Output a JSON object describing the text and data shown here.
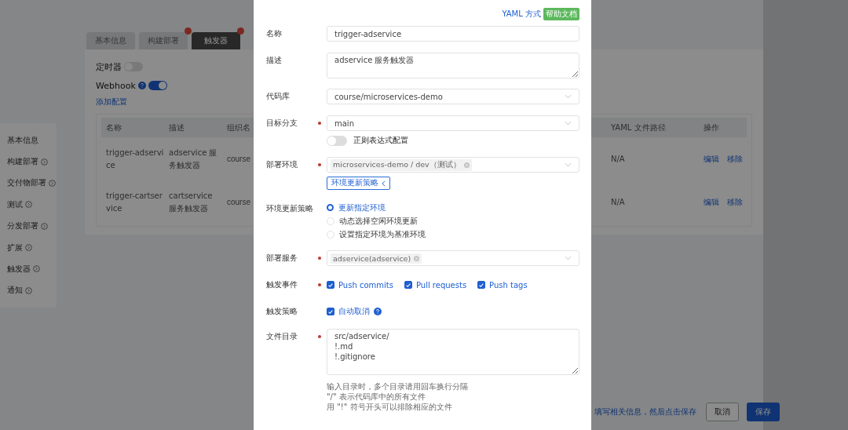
{
  "sidebar": [
    {
      "label": "基本信息",
      "expandable": false
    },
    {
      "label": "构建部署",
      "expandable": true
    },
    {
      "label": "交付物部署",
      "expandable": true
    },
    {
      "label": "测试",
      "expandable": true
    },
    {
      "label": "分发部署",
      "expandable": true
    },
    {
      "label": "扩展",
      "expandable": true
    },
    {
      "label": "触发器",
      "expandable": true
    },
    {
      "label": "通知",
      "expandable": true
    }
  ],
  "tabs": [
    {
      "label": "基本信息",
      "selected": false,
      "error": false
    },
    {
      "label": "构建部署",
      "selected": false,
      "error": true
    },
    {
      "label": "触发器",
      "selected": true,
      "error": true
    }
  ],
  "timer": {
    "label": "定时器",
    "on": false
  },
  "webhook": {
    "label": "Webhook",
    "on": true
  },
  "add_config": "添加配置",
  "table": {
    "columns": [
      "名称",
      "描述",
      "组织名",
      "YAML 文件路径",
      "操作"
    ],
    "rows": [
      {
        "cells": [
          "trigger-adservice",
          "adservice 服务触发器",
          "course",
          "N/A"
        ],
        "actions": [
          "编辑",
          "移除"
        ]
      },
      {
        "cells": [
          "trigger-cartservice",
          "cartservice 服务触发器",
          "course",
          "N/A"
        ],
        "actions": [
          "编辑",
          "移除"
        ]
      }
    ]
  },
  "footer": {
    "hint": "填写相关信息，然后点击保存",
    "cancel": "取消",
    "save": "保存"
  },
  "modal": {
    "yaml_link": "YAML 方式",
    "help_badge": "帮助文档",
    "fields": [
      {
        "kind": "input",
        "label": "名称",
        "required": false,
        "value": "trigger-adservice"
      },
      {
        "kind": "textarea",
        "label": "描述",
        "required": false,
        "value": "adservice 服务触发器"
      },
      {
        "kind": "select",
        "label": "代码库",
        "required": false,
        "value": "course/microservices-demo"
      },
      {
        "kind": "select",
        "label": "目标分支",
        "required": true,
        "value": "main",
        "toggle": {
          "label": "正则表达式配置",
          "on": false
        }
      },
      {
        "kind": "tags",
        "label": "部署环境",
        "required": true,
        "tags": [
          "microservices-demo / dev（测试）"
        ],
        "button": "环境更新策略"
      },
      {
        "kind": "radios",
        "label": "环境更新策略",
        "required": false,
        "options": [
          {
            "label": "更新指定环境",
            "selected": true
          },
          {
            "label": "动态选择空闲环境更新",
            "selected": false
          },
          {
            "label": "设置指定环境为基准环境",
            "selected": false
          }
        ]
      },
      {
        "kind": "tags",
        "label": "部署服务",
        "required": true,
        "tags": [
          "adservice(adservice)"
        ]
      },
      {
        "kind": "checkboxes",
        "label": "触发事件",
        "required": true,
        "options": [
          {
            "label": "Push commits",
            "checked": true,
            "help": false
          },
          {
            "label": "Pull requests",
            "checked": true,
            "help": false
          },
          {
            "label": "Push tags",
            "checked": true,
            "help": false
          }
        ]
      },
      {
        "kind": "checkboxes",
        "label": "触发策略",
        "required": false,
        "options": [
          {
            "label": "自动取消",
            "checked": true,
            "help": true
          }
        ]
      },
      {
        "kind": "textarea",
        "label": "文件目录",
        "required": true,
        "value": "src/adservice/\n!.md\n!.gitignore",
        "hints": [
          "输入目录时，多个目录请用回车换行分隔",
          "\"/\" 表示代码库中的所有文件",
          "用 \"!\" 符号开头可以排除相应的文件"
        ]
      }
    ]
  }
}
